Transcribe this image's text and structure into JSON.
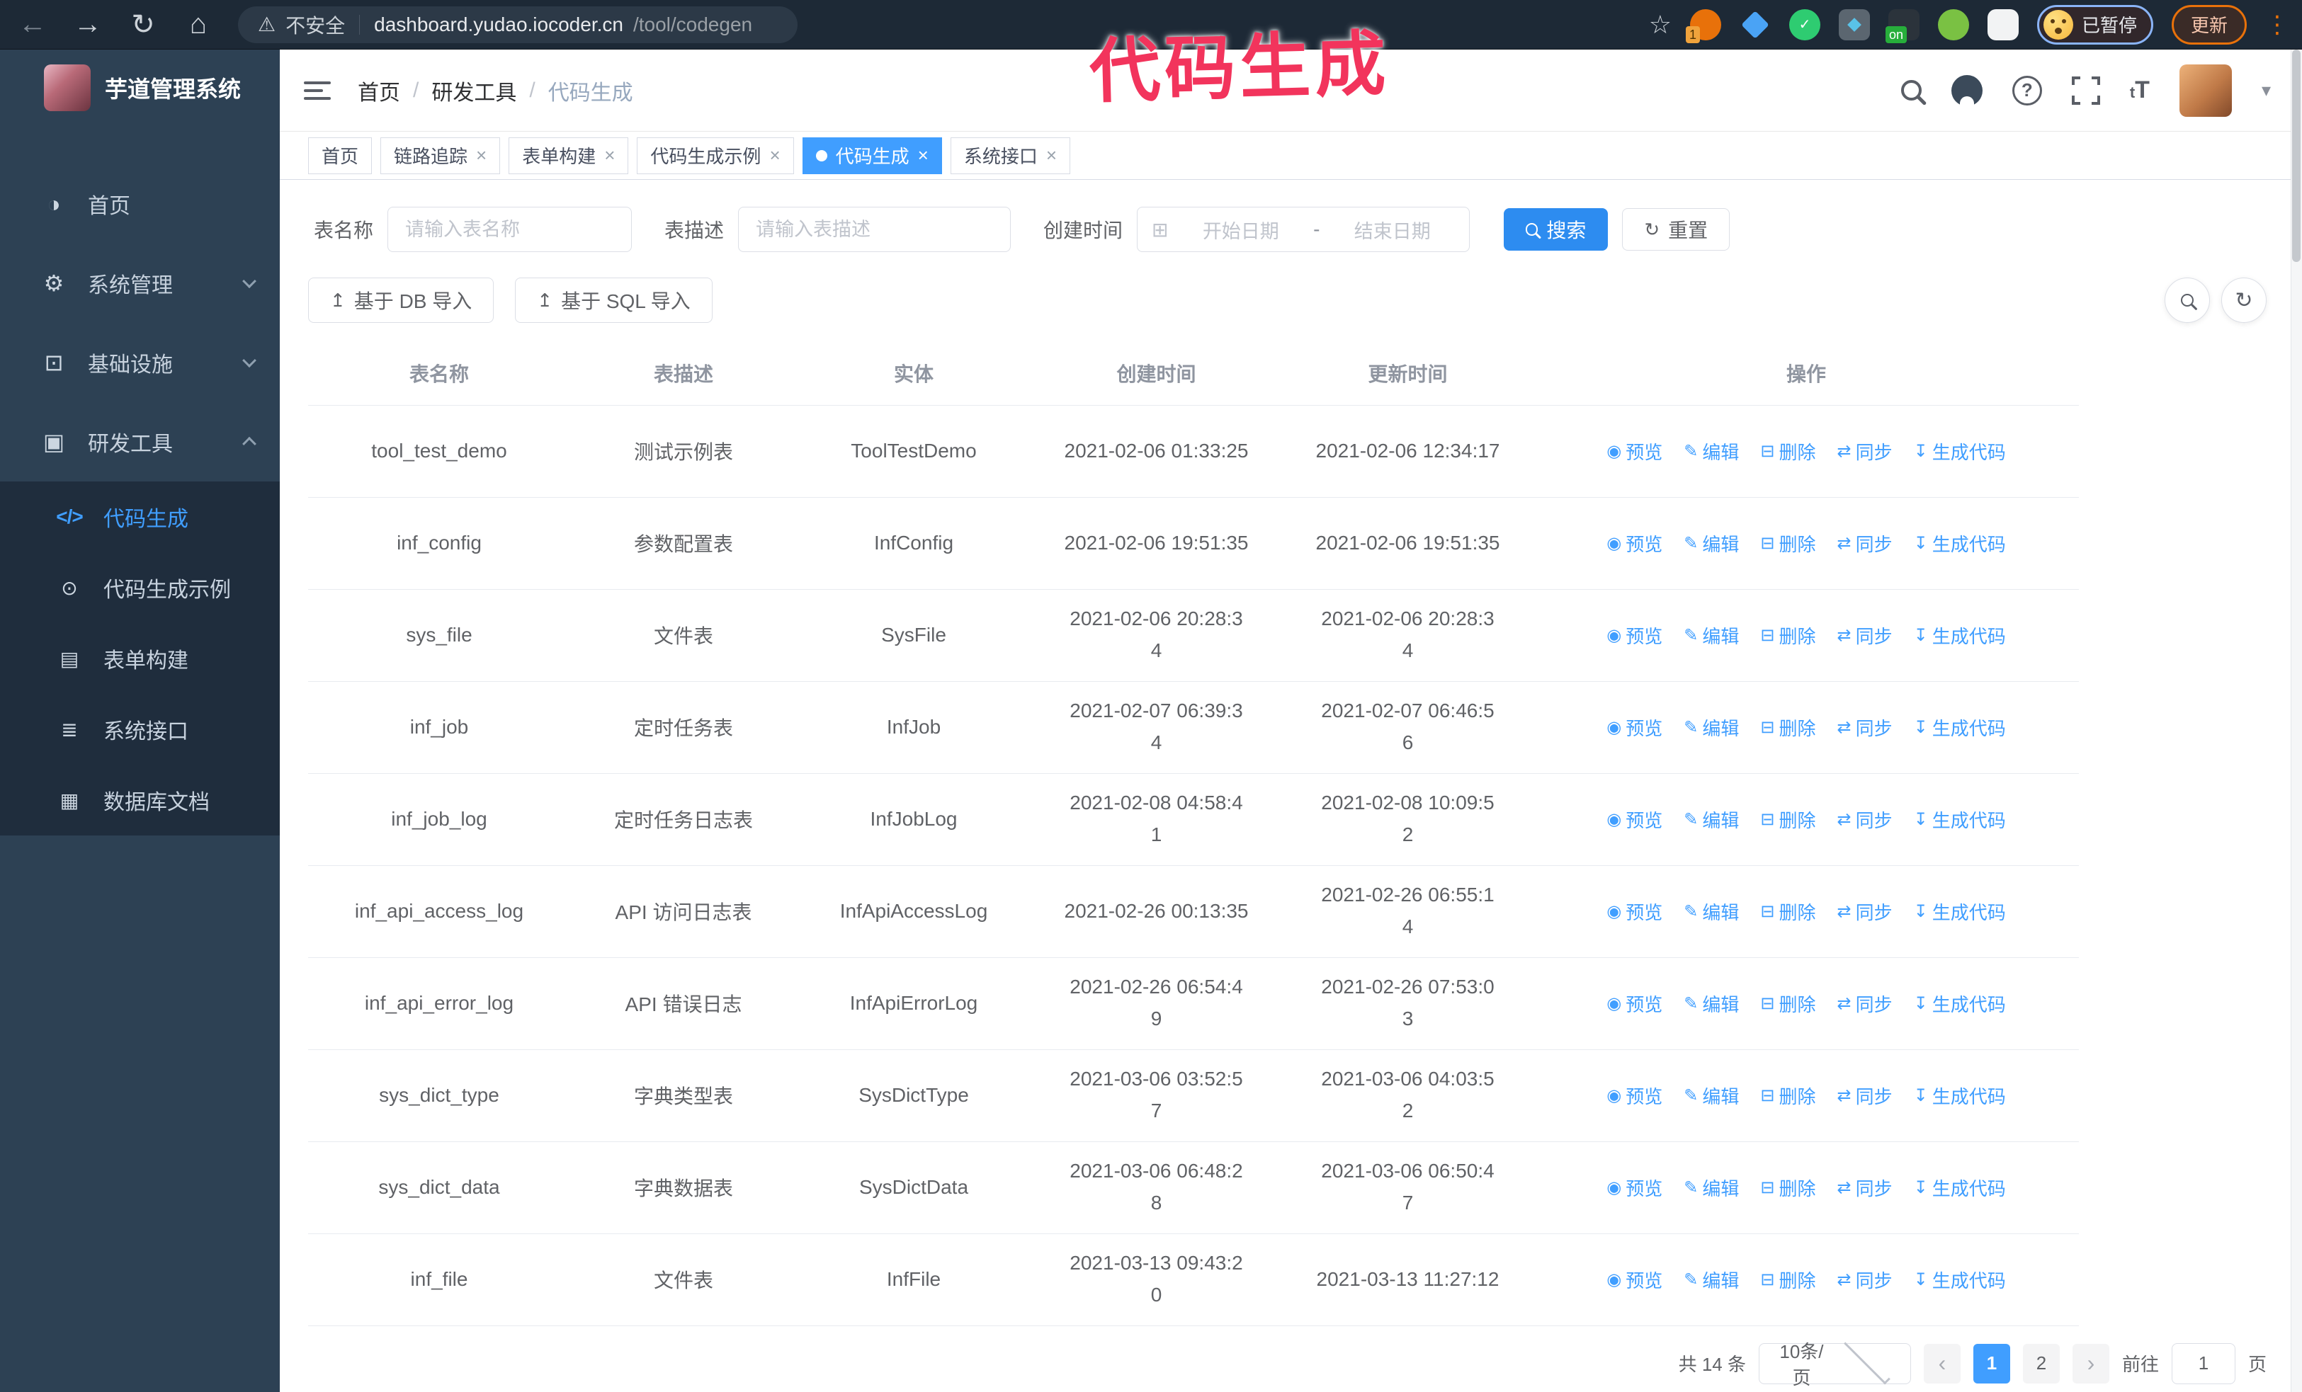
{
  "browser": {
    "security_label": "不安全",
    "url_host": "dashboard.yudao.iocoder.cn",
    "url_path": "/tool/codegen",
    "paused_badge": "已暂停",
    "update_button": "更新",
    "ext_badge_count": "1",
    "ext_badge_on": "on"
  },
  "annotation": {
    "text": "代码生成",
    "color": "#f2345c"
  },
  "icons": {
    "back": "←",
    "forward": "→",
    "reload": "↻",
    "home": "⌂",
    "warning": "⚠",
    "star": "☆",
    "kebab": "⋮",
    "caret": "▾",
    "calendar": "⊞",
    "upload": "↥",
    "refresh": "↻",
    "eye": "◉",
    "edit": "✎",
    "trash": "⊟",
    "sync": "⇄",
    "download": "↧",
    "menu_home": "◑",
    "menu_gear": "⚙",
    "menu_monitor": "⊡",
    "menu_toolbox": "▣",
    "menu_code": "</>",
    "menu_example": "⊙",
    "menu_form": "▤",
    "menu_sliders": "≣",
    "menu_db": "▦",
    "prev": "‹",
    "next": "›",
    "font_size": "tT"
  },
  "sidebar": {
    "title": "芋道管理系统",
    "items": [
      {
        "label": "首页"
      },
      {
        "label": "系统管理"
      },
      {
        "label": "基础设施"
      },
      {
        "label": "研发工具"
      }
    ],
    "subitems": [
      {
        "label": "代码生成"
      },
      {
        "label": "代码生成示例"
      },
      {
        "label": "表单构建"
      },
      {
        "label": "系统接口"
      },
      {
        "label": "数据库文档"
      }
    ]
  },
  "header": {
    "breadcrumb": [
      "首页",
      "研发工具",
      "代码生成"
    ],
    "separator": "/"
  },
  "tabs": [
    {
      "label": "首页"
    },
    {
      "label": "链路追踪"
    },
    {
      "label": "表单构建"
    },
    {
      "label": "代码生成示例"
    },
    {
      "label": "代码生成"
    },
    {
      "label": "系统接口"
    }
  ],
  "filters": {
    "table_name_label": "表名称",
    "table_name_placeholder": "请输入表名称",
    "table_desc_label": "表描述",
    "table_desc_placeholder": "请输入表描述",
    "create_time_label": "创建时间",
    "start_date_placeholder": "开始日期",
    "end_date_placeholder": "结束日期",
    "range_separator": "-",
    "search_label": "搜索",
    "reset_label": "重置"
  },
  "toolbar": {
    "import_db_label": "基于 DB 导入",
    "import_sql_label": "基于 SQL 导入"
  },
  "table": {
    "columns": [
      "表名称",
      "表描述",
      "实体",
      "创建时间",
      "更新时间",
      "操作"
    ],
    "actions": [
      "预览",
      "编辑",
      "删除",
      "同步",
      "生成代码"
    ],
    "rows": [
      {
        "name": "tool_test_demo",
        "desc": "测试示例表",
        "entity": "ToolTestDemo",
        "created": "2021-02-06 01:33:25",
        "updated": "2021-02-06 12:34:17"
      },
      {
        "name": "inf_config",
        "desc": "参数配置表",
        "entity": "InfConfig",
        "created": "2021-02-06 19:51:35",
        "updated": "2021-02-06 19:51:35"
      },
      {
        "name": "sys_file",
        "desc": "文件表",
        "entity": "SysFile",
        "created": "2021-02-06 20:28:3\n4",
        "updated": "2021-02-06 20:28:3\n4"
      },
      {
        "name": "inf_job",
        "desc": "定时任务表",
        "entity": "InfJob",
        "created": "2021-02-07 06:39:3\n4",
        "updated": "2021-02-07 06:46:5\n6"
      },
      {
        "name": "inf_job_log",
        "desc": "定时任务日志表",
        "entity": "InfJobLog",
        "created": "2021-02-08 04:58:4\n1",
        "updated": "2021-02-08 10:09:5\n2"
      },
      {
        "name": "inf_api_access_log",
        "desc": "API 访问日志表",
        "entity": "InfApiAccessLog",
        "created": "2021-02-26 00:13:35",
        "updated": "2021-02-26 06:55:1\n4"
      },
      {
        "name": "inf_api_error_log",
        "desc": "API 错误日志",
        "entity": "InfApiErrorLog",
        "created": "2021-02-26 06:54:4\n9",
        "updated": "2021-02-26 07:53:0\n3"
      },
      {
        "name": "sys_dict_type",
        "desc": "字典类型表",
        "entity": "SysDictType",
        "created": "2021-03-06 03:52:5\n7",
        "updated": "2021-03-06 04:03:5\n2"
      },
      {
        "name": "sys_dict_data",
        "desc": "字典数据表",
        "entity": "SysDictData",
        "created": "2021-03-06 06:48:2\n8",
        "updated": "2021-03-06 06:50:4\n7"
      },
      {
        "name": "inf_file",
        "desc": "文件表",
        "entity": "InfFile",
        "created": "2021-03-13 09:43:2\n0",
        "updated": "2021-03-13 11:27:12"
      }
    ]
  },
  "pagination": {
    "total": "共 14 条",
    "page_size": "10条/页",
    "pages": [
      "1",
      "2"
    ],
    "goto_label": "前往",
    "goto_value": "1",
    "goto_suffix": "页"
  },
  "colors": {
    "accent": "#409eff",
    "primary_button": "#2d8cf0",
    "sidebar_bg": "#2d4154",
    "submenu_bg": "#1f2d3d",
    "chrome_bg": "#1d2936",
    "annotation": "#f2345c"
  }
}
